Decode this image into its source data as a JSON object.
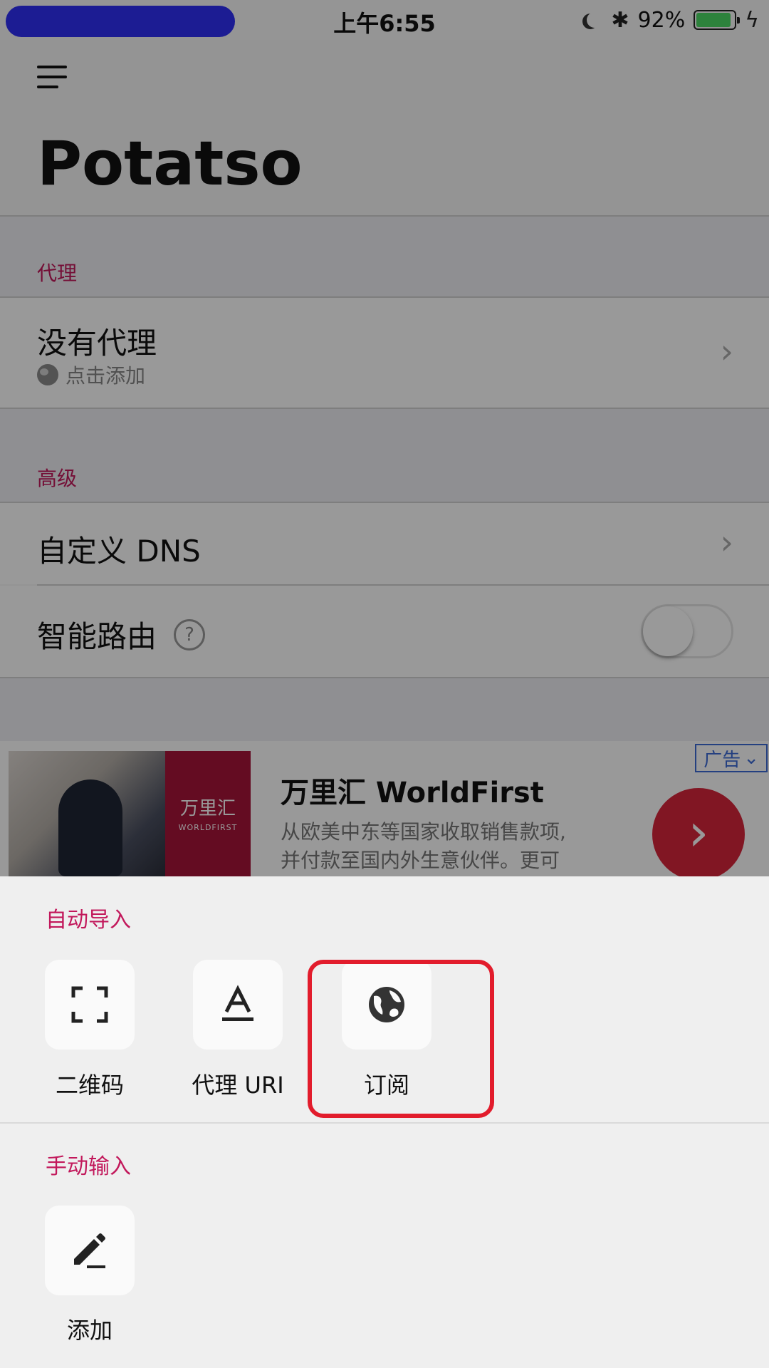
{
  "status_bar": {
    "time": "上午6:55",
    "battery_percent": "92%",
    "battery_level": 0.92,
    "battery_color": "#4cd964"
  },
  "app": {
    "title": "Potatso"
  },
  "proxy_section": {
    "label": "代理",
    "row_title": "没有代理",
    "row_subtitle": "点击添加"
  },
  "advanced_section": {
    "label": "高级",
    "dns_label": "自定义 DNS",
    "smart_routing_label": "智能路由",
    "smart_routing_help": "?",
    "smart_routing_enabled": false
  },
  "ad": {
    "badge": "广告",
    "brand_cn": "万里汇",
    "brand_en": "WORLDFIRST",
    "title": "万里汇 WorldFirst",
    "desc_line1": "从欧美中东等国家收取销售款项,",
    "desc_line2": "并付款至国内外生意伙伴。更可"
  },
  "sheet": {
    "auto_import_label": "自动导入",
    "auto_import_items": [
      {
        "label": "二维码",
        "icon": "qr-scan-icon"
      },
      {
        "label": "代理 URI",
        "icon": "text-format-icon"
      },
      {
        "label": "订阅",
        "icon": "globe-icon"
      }
    ],
    "manual_label": "手动输入",
    "manual_items": [
      {
        "label": "添加",
        "icon": "pencil-icon"
      }
    ]
  },
  "colors": {
    "accent": "#c2185b",
    "highlight": "#e21c2c",
    "ad_button": "#d8263b"
  }
}
